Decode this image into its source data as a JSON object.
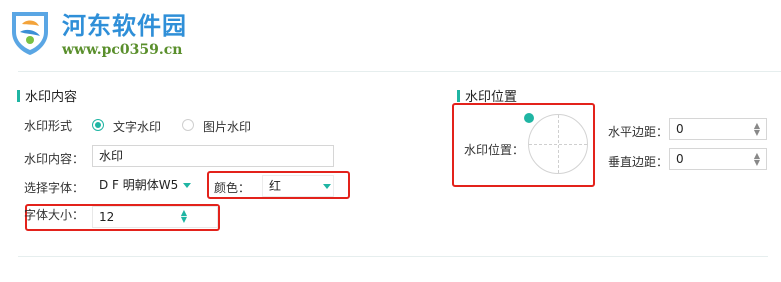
{
  "watermark": {
    "title": "河东软件园",
    "url": "www.pc0359.cn"
  },
  "content_section": {
    "title": "水印内容",
    "form_label": "水印形式",
    "options": [
      {
        "label": "文字水印",
        "selected": true
      },
      {
        "label": "图片水印",
        "selected": false
      }
    ],
    "content_label": "水印内容：",
    "content_value": "水印",
    "font_label": "选择字体：",
    "font_value": "D F 明朝体W5",
    "color_label": "颜色：",
    "color_value": "红",
    "size_label": "字体大小：",
    "size_value": "12"
  },
  "position_section": {
    "title": "水印位置",
    "position_label": "水印位置：",
    "h_margin_label": "水平边距：",
    "h_margin_value": "0",
    "v_margin_label": "垂直边距：",
    "v_margin_value": "0"
  },
  "colors": {
    "accent": "#1fb5a3",
    "highlight": "#e3221b",
    "logo_blue": "#2f8fd8",
    "logo_green": "#5a8f2c"
  },
  "icons": {
    "logo": "shield-logo-icon",
    "dropdown": "caret-down-icon",
    "spinner": "spinner-arrows-icon"
  }
}
